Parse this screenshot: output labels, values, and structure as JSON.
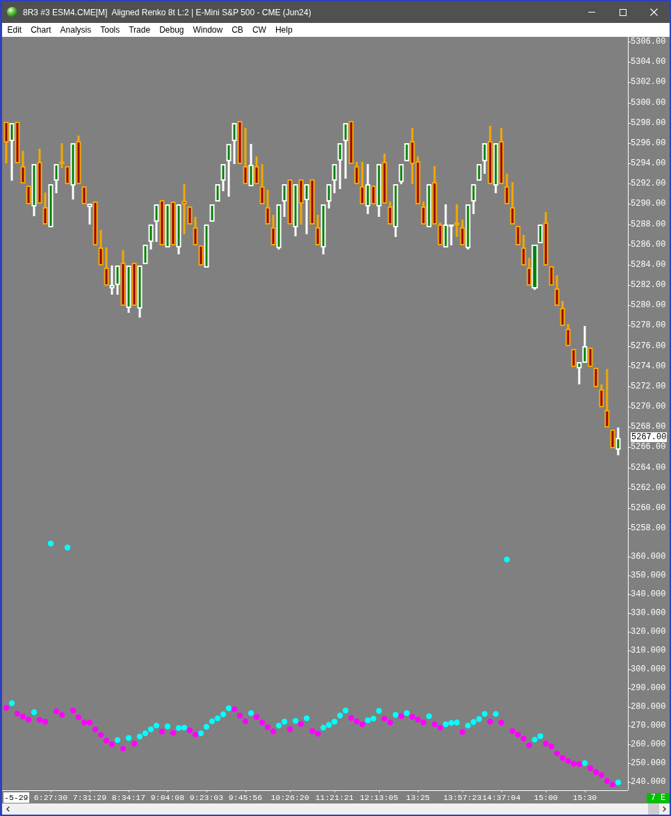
{
  "window": {
    "title": "8R3 #3 ESM4.CME[M]  Aligned Renko 8t L:2 | E-Mini S&P 500 - CME (Jun24)"
  },
  "menu": [
    "Edit",
    "Chart",
    "Analysis",
    "Tools",
    "Trade",
    "Debug",
    "Window",
    "CB",
    "CW",
    "Help"
  ],
  "price_pane": {
    "axis_labels": [
      "5306.00",
      "5304.00",
      "5302.00",
      "5300.00",
      "5298.00",
      "5296.00",
      "5294.00",
      "5292.00",
      "5290.00",
      "5288.00",
      "5286.00",
      "5284.00",
      "5282.00",
      "5280.00",
      "5278.00",
      "5276.00",
      "5274.00",
      "5272.00",
      "5270.00",
      "5268.00",
      "5266.00",
      "5264.00",
      "5262.00",
      "5260.00",
      "5258.00"
    ],
    "last_price": "5267.00"
  },
  "indicator_pane": {
    "chart_data": {
      "type": "scatter",
      "categories": [
        null,
        null,
        null,
        null,
        null,
        null,
        null,
        null,
        "6:27:30",
        null,
        null,
        null,
        null,
        null,
        null,
        "7:31:29",
        null,
        null,
        null,
        null,
        null,
        null,
        "8:34:17",
        null,
        null,
        null,
        null,
        null,
        null,
        "9:04:08",
        null,
        null,
        null,
        null,
        null,
        null,
        "9:23:03",
        null,
        null,
        null,
        null,
        null,
        null,
        "9:45:56",
        null,
        null,
        null,
        null,
        null,
        null,
        null,
        "10:26:20",
        null,
        null,
        null,
        null,
        null,
        null,
        null,
        "11:21:21",
        null,
        null,
        null,
        null,
        null,
        null,
        null,
        "12:13:05",
        null,
        null,
        null,
        null,
        null,
        null,
        "13:25",
        null,
        null,
        null,
        null,
        null,
        null,
        null,
        "13:57:23",
        null,
        null,
        null,
        null,
        null,
        null,
        "14:37:04",
        null,
        null,
        null,
        null,
        null,
        null,
        null,
        "15:00",
        null,
        null,
        null,
        null,
        null,
        null,
        "15:30",
        null,
        null,
        null,
        null,
        null,
        null
      ],
      "series": [
        {
          "color": "#00ffff",
          "values": [
            null,
            282.0,
            null,
            null,
            null,
            277.2,
            null,
            null,
            367.1,
            null,
            null,
            365.0,
            null,
            null,
            null,
            null,
            null,
            null,
            null,
            null,
            262.4,
            null,
            263.5,
            null,
            264.2,
            266.0,
            268.1,
            270.1,
            null,
            269.7,
            null,
            268.8,
            269.0,
            null,
            null,
            266.0,
            269.4,
            272.4,
            274.0,
            276.1,
            279.3,
            null,
            null,
            null,
            276.7,
            null,
            null,
            null,
            null,
            270.1,
            272.2,
            null,
            272.6,
            null,
            274.0,
            null,
            null,
            269.0,
            270.4,
            272.2,
            275.4,
            278.1,
            null,
            null,
            null,
            272.9,
            273.8,
            277.9,
            null,
            null,
            275.8,
            null,
            276.7,
            null,
            null,
            null,
            275.1,
            null,
            null,
            270.8,
            271.5,
            271.7,
            null,
            270.1,
            272.0,
            273.6,
            276.3,
            null,
            276.3,
            null,
            358.6,
            null,
            null,
            null,
            null,
            262.6,
            264.4,
            null,
            null,
            null,
            null,
            null,
            null,
            null,
            250.1,
            null,
            null,
            null,
            null,
            null,
            239.8
          ]
        },
        {
          "color": "#ff00ff",
          "values": [
            279.5,
            null,
            276.5,
            274.9,
            273.3,
            null,
            273.1,
            272.2,
            null,
            277.7,
            275.8,
            null,
            278.1,
            274.5,
            271.7,
            271.7,
            268.1,
            265.1,
            262.1,
            260.1,
            null,
            257.8,
            null,
            260.5,
            null,
            null,
            null,
            null,
            266.9,
            null,
            266.2,
            null,
            null,
            267.6,
            265.3,
            null,
            null,
            null,
            null,
            null,
            null,
            278.8,
            275.4,
            272.4,
            null,
            274.7,
            271.7,
            269.2,
            266.9,
            null,
            null,
            268.1,
            null,
            271.0,
            null,
            267.2,
            265.8,
            null,
            null,
            null,
            null,
            null,
            274.2,
            272.4,
            270.8,
            null,
            null,
            null,
            273.8,
            271.7,
            null,
            275.1,
            null,
            274.7,
            273.3,
            271.7,
            null,
            270.8,
            269.0,
            null,
            null,
            null,
            266.7,
            null,
            null,
            null,
            null,
            272.2,
            null,
            271.7,
            null,
            267.2,
            265.3,
            263.1,
            259.6,
            null,
            null,
            260.5,
            259.0,
            255.3,
            252.8,
            251.2,
            249.8,
            249.6,
            null,
            247.3,
            245.3,
            243.7,
            240.5,
            238.6,
            null
          ]
        }
      ],
      "ylim": [
        235.6,
        637.2
      ],
      "yticks": [
        {
          "value": 360,
          "label": "360.000"
        },
        {
          "value": 350,
          "label": "350.000"
        },
        {
          "value": 340,
          "label": "340.000"
        },
        {
          "value": 330,
          "label": "330.000"
        },
        {
          "value": 320,
          "label": "320.000"
        },
        {
          "value": 310,
          "label": "310.000"
        },
        {
          "value": 300,
          "label": "300.000"
        },
        {
          "value": 290,
          "label": "290.000"
        },
        {
          "value": 280,
          "label": "280.000"
        },
        {
          "value": 270,
          "label": "270.000"
        },
        {
          "value": 260,
          "label": "260.000"
        },
        {
          "value": 250,
          "label": "250.000"
        },
        {
          "value": 240,
          "label": "240.000"
        }
      ]
    }
  },
  "date_label": {
    "text": "-5-29",
    "highlighted": true
  },
  "status_badge": "7 E"
}
